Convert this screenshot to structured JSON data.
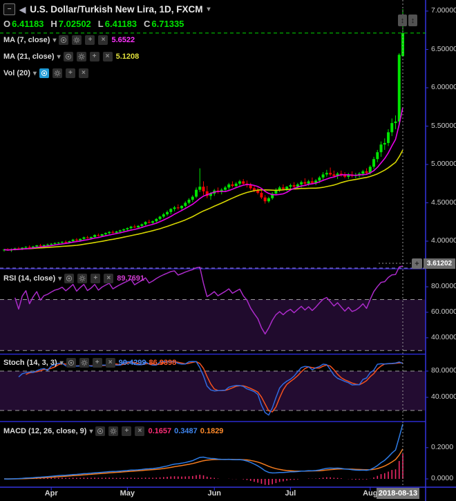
{
  "header": {
    "symbol_title": "U.S. Dollar/Turkish New Lira, 1D, FXCM",
    "ohlc": {
      "o_label": "O",
      "o_value": "6.41183",
      "h_label": "H",
      "h_value": "7.02502",
      "l_label": "L",
      "l_value": "6.41183",
      "c_label": "C",
      "c_value": "6.71335"
    }
  },
  "legends": {
    "ma7": {
      "label": "MA (7, close)",
      "value": "5.6522"
    },
    "ma21": {
      "label": "MA (21, close)",
      "value": "5.1208"
    },
    "vol": {
      "label": "Vol (20)"
    },
    "rsi": {
      "label": "RSI (14, close)",
      "value": "89.7691"
    },
    "stoch": {
      "label": "Stoch (14, 3, 3)",
      "k_value": "90.4299",
      "d_value": "86.9398"
    },
    "macd": {
      "label": "MACD (12, 26, close, 9)",
      "hist_value": "0.1657",
      "macd_value": "0.3487",
      "signal_value": "0.1829"
    }
  },
  "axes": {
    "main_price_labels": [
      "7.00000",
      "6.50000",
      "6.00000",
      "5.50000",
      "5.00000",
      "4.50000",
      "4.00000"
    ],
    "rsi_labels": [
      "80.0000",
      "60.0000",
      "40.0000"
    ],
    "stoch_labels": [
      "80.0000",
      "40.0000"
    ],
    "macd_labels": [
      "0.2000",
      "0.0000"
    ],
    "time_labels": [
      "Apr",
      "May",
      "Jun",
      "Jul",
      "Aug"
    ],
    "crosshair_date": "2018-08-13",
    "crosshair_price": "3.61202"
  },
  "colors": {
    "candle_up": "#00e400",
    "candle_down": "#f20505",
    "ma7": "#e800e8",
    "ma21": "#d6d600",
    "rsi_line": "#ab2bc9",
    "stoch_k": "#2f6be0",
    "stoch_d": "#f4511e",
    "macd_line": "#2e7de8",
    "macd_signal": "#f57c1f",
    "macd_hist": "#f02868",
    "current_price_line": "#00c400",
    "axis_line": "#3434e0"
  },
  "chart_data": {
    "type": "candlestick",
    "title": "U.S. Dollar/Turkish New Lira, 1D, FXCM",
    "timeframe": "1D",
    "exchange": "FXCM",
    "price_axis_ticks": [
      7.0,
      6.5,
      6.0,
      5.5,
      5.0,
      4.5,
      4.0
    ],
    "current_price": 6.71335,
    "last_bar": {
      "open": 6.41183,
      "high": 7.02502,
      "low": 6.41183,
      "close": 6.71335,
      "date": "2018-08-13"
    },
    "crosshair_index": 110,
    "month_start_indices": [
      13,
      34,
      58,
      79,
      101
    ],
    "month_labels": [
      "Apr",
      "May",
      "Jun",
      "Jul",
      "Aug"
    ],
    "candles_ohlc": [
      [
        3.88,
        3.9,
        3.865,
        3.89
      ],
      [
        3.89,
        3.91,
        3.875,
        3.88
      ],
      [
        3.88,
        3.905,
        3.86,
        3.895
      ],
      [
        3.895,
        3.915,
        3.88,
        3.905
      ],
      [
        3.905,
        3.925,
        3.89,
        3.9
      ],
      [
        3.9,
        3.92,
        3.885,
        3.915
      ],
      [
        3.915,
        3.935,
        3.9,
        3.925
      ],
      [
        3.925,
        3.945,
        3.905,
        3.915
      ],
      [
        3.915,
        3.94,
        3.9,
        3.93
      ],
      [
        3.93,
        3.95,
        3.915,
        3.945
      ],
      [
        3.945,
        3.965,
        3.925,
        3.935
      ],
      [
        3.935,
        3.955,
        3.92,
        3.95
      ],
      [
        3.95,
        3.97,
        3.935,
        3.955
      ],
      [
        3.955,
        3.975,
        3.945,
        3.965
      ],
      [
        3.965,
        3.985,
        3.955,
        3.975
      ],
      [
        3.975,
        3.99,
        3.96,
        3.98
      ],
      [
        3.98,
        4.0,
        3.97,
        3.99
      ],
      [
        3.99,
        4.01,
        3.975,
        3.985
      ],
      [
        3.985,
        4.005,
        3.97,
        4.0
      ],
      [
        4.0,
        4.03,
        3.99,
        4.02
      ],
      [
        4.02,
        4.04,
        4.0,
        4.01
      ],
      [
        4.01,
        4.035,
        3.995,
        4.03
      ],
      [
        4.03,
        4.06,
        4.02,
        4.05
      ],
      [
        4.05,
        4.07,
        4.03,
        4.04
      ],
      [
        4.04,
        4.06,
        4.02,
        4.055
      ],
      [
        4.055,
        4.09,
        4.045,
        4.08
      ],
      [
        4.08,
        4.1,
        4.06,
        4.07
      ],
      [
        4.07,
        4.095,
        4.055,
        4.09
      ],
      [
        4.09,
        4.115,
        4.075,
        4.105
      ],
      [
        4.105,
        4.13,
        4.09,
        4.12
      ],
      [
        4.12,
        4.14,
        4.1,
        4.11
      ],
      [
        4.11,
        4.135,
        4.095,
        4.125
      ],
      [
        4.125,
        4.15,
        4.11,
        4.14
      ],
      [
        4.14,
        4.165,
        4.12,
        4.155
      ],
      [
        4.155,
        4.18,
        4.14,
        4.17
      ],
      [
        4.17,
        4.2,
        4.155,
        4.19
      ],
      [
        4.19,
        4.215,
        4.17,
        4.18
      ],
      [
        4.18,
        4.21,
        4.165,
        4.2
      ],
      [
        4.2,
        4.23,
        4.185,
        4.22
      ],
      [
        4.22,
        4.26,
        4.205,
        4.25
      ],
      [
        4.25,
        4.28,
        4.23,
        4.24
      ],
      [
        4.24,
        4.27,
        4.22,
        4.26
      ],
      [
        4.26,
        4.3,
        4.245,
        4.29
      ],
      [
        4.29,
        4.33,
        4.27,
        4.32
      ],
      [
        4.32,
        4.37,
        4.3,
        4.35
      ],
      [
        4.35,
        4.4,
        4.33,
        4.38
      ],
      [
        4.38,
        4.43,
        4.35,
        4.42
      ],
      [
        4.42,
        4.46,
        4.39,
        4.44
      ],
      [
        4.44,
        4.48,
        4.41,
        4.43
      ],
      [
        4.43,
        4.47,
        4.4,
        4.46
      ],
      [
        4.46,
        4.52,
        4.44,
        4.5
      ],
      [
        4.5,
        4.56,
        4.48,
        4.54
      ],
      [
        4.54,
        4.6,
        4.51,
        4.58
      ],
      [
        4.58,
        4.7,
        4.56,
        4.67
      ],
      [
        4.67,
        4.95,
        4.64,
        4.71
      ],
      [
        4.71,
        4.78,
        4.6,
        4.65
      ],
      [
        4.65,
        4.72,
        4.56,
        4.59
      ],
      [
        4.59,
        4.64,
        4.54,
        4.62
      ],
      [
        4.62,
        4.68,
        4.59,
        4.66
      ],
      [
        4.66,
        4.7,
        4.62,
        4.64
      ],
      [
        4.64,
        4.69,
        4.61,
        4.67
      ],
      [
        4.67,
        4.72,
        4.64,
        4.7
      ],
      [
        4.7,
        4.76,
        4.67,
        4.74
      ],
      [
        4.74,
        4.78,
        4.7,
        4.72
      ],
      [
        4.72,
        4.77,
        4.69,
        4.75
      ],
      [
        4.75,
        4.8,
        4.72,
        4.78
      ],
      [
        4.78,
        4.81,
        4.73,
        4.75
      ],
      [
        4.75,
        4.79,
        4.7,
        4.73
      ],
      [
        4.73,
        4.76,
        4.67,
        4.69
      ],
      [
        4.69,
        4.72,
        4.64,
        4.66
      ],
      [
        4.66,
        4.7,
        4.61,
        4.63
      ],
      [
        4.63,
        4.66,
        4.55,
        4.57
      ],
      [
        4.57,
        4.6,
        4.49,
        4.52
      ],
      [
        4.52,
        4.58,
        4.5,
        4.56
      ],
      [
        4.56,
        4.64,
        4.54,
        4.62
      ],
      [
        4.62,
        4.69,
        4.6,
        4.67
      ],
      [
        4.67,
        4.72,
        4.64,
        4.7
      ],
      [
        4.7,
        4.74,
        4.66,
        4.68
      ],
      [
        4.68,
        4.72,
        4.65,
        4.71
      ],
      [
        4.71,
        4.75,
        4.68,
        4.73
      ],
      [
        4.73,
        4.77,
        4.69,
        4.71
      ],
      [
        4.71,
        4.76,
        4.68,
        4.74
      ],
      [
        4.74,
        4.79,
        4.7,
        4.77
      ],
      [
        4.77,
        4.82,
        4.73,
        4.75
      ],
      [
        4.75,
        4.8,
        4.72,
        4.78
      ],
      [
        4.78,
        4.83,
        4.74,
        4.76
      ],
      [
        4.76,
        4.81,
        4.73,
        4.79
      ],
      [
        4.79,
        4.85,
        4.76,
        4.83
      ],
      [
        4.83,
        4.9,
        4.8,
        4.87
      ],
      [
        4.87,
        4.93,
        4.84,
        4.89
      ],
      [
        4.89,
        4.96,
        4.85,
        4.87
      ],
      [
        4.87,
        4.92,
        4.83,
        4.85
      ],
      [
        4.85,
        4.9,
        4.81,
        4.88
      ],
      [
        4.88,
        4.92,
        4.84,
        4.86
      ],
      [
        4.86,
        4.9,
        4.82,
        4.84
      ],
      [
        4.84,
        4.89,
        4.81,
        4.87
      ],
      [
        4.87,
        4.91,
        4.83,
        4.85
      ],
      [
        4.85,
        4.89,
        4.82,
        4.86
      ],
      [
        4.86,
        4.9,
        4.83,
        4.88
      ],
      [
        4.88,
        4.93,
        4.85,
        4.91
      ],
      [
        4.91,
        4.95,
        4.87,
        4.89
      ],
      [
        4.89,
        4.99,
        4.87,
        4.97
      ],
      [
        4.97,
        5.1,
        4.94,
        5.07
      ],
      [
        5.07,
        5.19,
        5.03,
        5.16
      ],
      [
        5.16,
        5.3,
        5.1,
        5.26
      ],
      [
        5.26,
        5.34,
        5.19,
        5.28
      ],
      [
        5.28,
        5.46,
        5.24,
        5.42
      ],
      [
        5.42,
        5.6,
        5.37,
        5.54
      ],
      [
        5.54,
        5.64,
        5.46,
        5.56
      ],
      [
        5.56,
        6.45,
        5.51,
        6.43
      ],
      [
        6.412,
        7.025,
        6.412,
        6.713
      ]
    ],
    "overlays": [
      {
        "name": "MA",
        "period": 7,
        "source": "close",
        "last_value": 5.6522
      },
      {
        "name": "MA",
        "period": 21,
        "source": "close",
        "last_value": 5.1208
      },
      {
        "name": "Vol",
        "period": 20
      }
    ],
    "panes": [
      {
        "name": "RSI",
        "params": [
          14,
          "close"
        ],
        "last_value": 89.7691,
        "levels": [
          70,
          30
        ],
        "axis_ticks": [
          80,
          60,
          40
        ]
      },
      {
        "name": "Stoch",
        "params": [
          14,
          3,
          3
        ],
        "k_last": 90.4299,
        "d_last": 86.9398,
        "levels": [
          80,
          20
        ],
        "axis_ticks": [
          80,
          40
        ]
      },
      {
        "name": "MACD",
        "params": [
          12,
          26,
          "close",
          9
        ],
        "hist_last": 0.1657,
        "macd_last": 0.3487,
        "signal_last": 0.1829,
        "axis_ticks": [
          0.2,
          0.0
        ]
      }
    ]
  }
}
